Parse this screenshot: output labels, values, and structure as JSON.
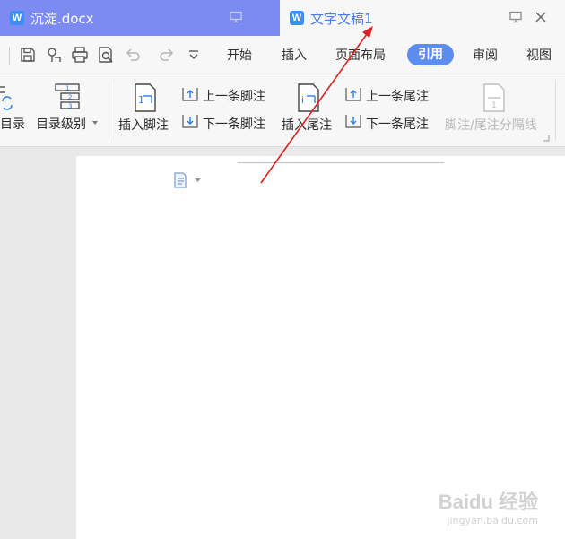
{
  "tabs": [
    {
      "title": "沉淀.docx",
      "logo": "W"
    },
    {
      "title": "文字文稿1",
      "logo": "W"
    }
  ],
  "menu": {
    "items": [
      "开始",
      "插入",
      "页面布局",
      "引用",
      "审阅",
      "视图"
    ],
    "active": "引用"
  },
  "ribbon": {
    "toc_label": "目录",
    "toc_level_label": "目录级别",
    "insert_footnote": "插入脚注",
    "prev_footnote": "上一条脚注",
    "next_footnote": "下一条脚注",
    "insert_endnote": "插入尾注",
    "prev_endnote": "上一条尾注",
    "next_endnote": "下一条尾注",
    "separator_line": "脚注/尾注分隔线"
  },
  "watermark": {
    "brand": "Baidu 经验",
    "url": "jingyan.baidu.com"
  },
  "colors": {
    "active_tab": "#7b8bf1",
    "accent": "#5b8def",
    "arrow": "#e02020"
  }
}
